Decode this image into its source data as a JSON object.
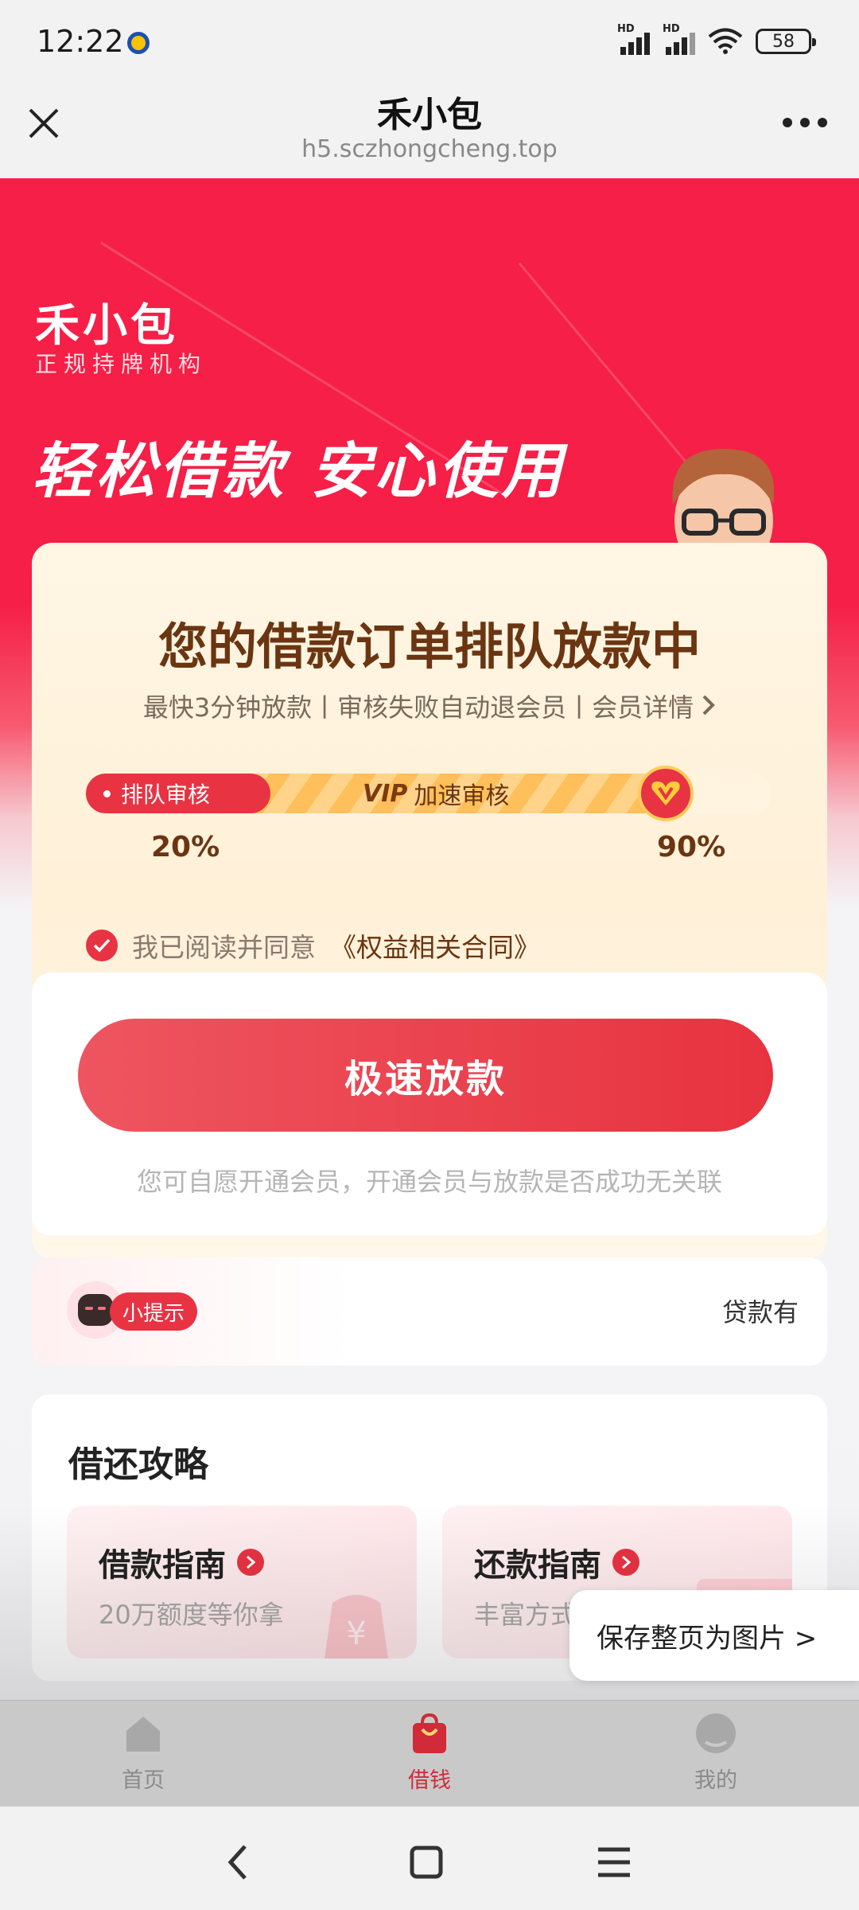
{
  "status_bar": {
    "time": "12:22",
    "battery": "58"
  },
  "browser": {
    "title": "禾小包",
    "url": "h5.sczhongcheng.top"
  },
  "hero": {
    "brand_name": "禾小包",
    "brand_tagline": "正规持牌机构",
    "slogan": "轻松借款  安心使用"
  },
  "queue_card": {
    "title": "您的借款订单排队放款中",
    "subtitle": "最快3分钟放款丨审核失败自动退会员丨会员详情",
    "progress": {
      "stage1_label": "排队审核",
      "stage2_label": "加速审核",
      "vip_icon_text": "VIP",
      "percent_left": "20%",
      "percent_right": "90%",
      "fill_fraction": 0.85
    },
    "agree_text": "我已阅读并同意",
    "contract_link": "《权益相关合同》"
  },
  "release": {
    "button_label": "极速放款",
    "note": "您可自愿开通会员，开通会员与放款是否成功无关联"
  },
  "tip": {
    "badge": "小提示",
    "scroll_text": "贷款有"
  },
  "guide": {
    "title": "借还攻略",
    "cards": [
      {
        "title": "借款指南",
        "subtitle": "20万额度等你拿"
      },
      {
        "title": "还款指南",
        "subtitle": "丰富方式"
      }
    ]
  },
  "save_float": {
    "label": "保存整页为图片 >"
  },
  "tabs": [
    {
      "label": "首页",
      "icon": "home-icon"
    },
    {
      "label": "借钱",
      "icon": "shopping-bag-icon"
    },
    {
      "label": "我的",
      "icon": "profile-icon"
    }
  ],
  "colors": {
    "brand_red": "#f51f47",
    "button_red": "#e7333f",
    "title_brown": "#6b3511"
  }
}
